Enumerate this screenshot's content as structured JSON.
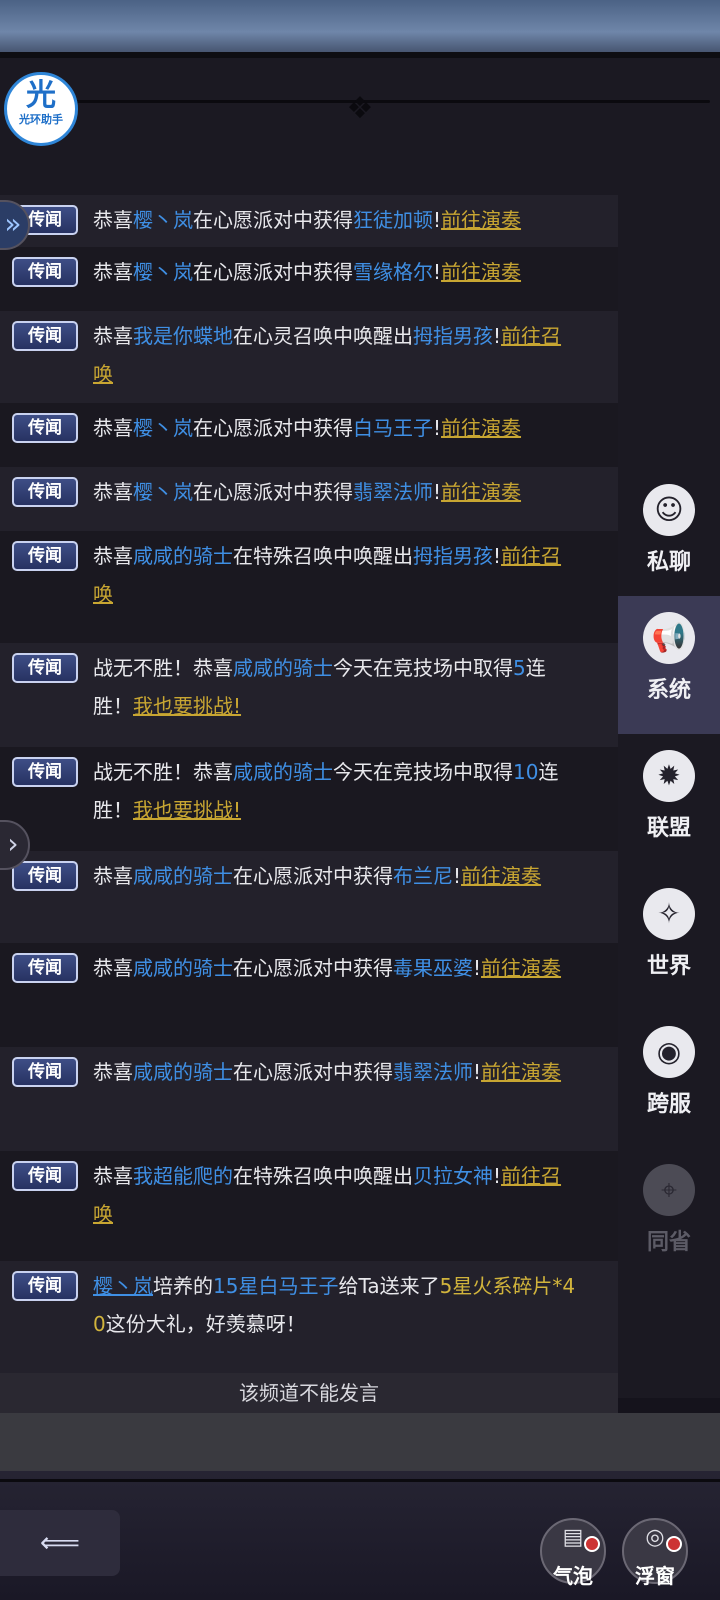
{
  "assistant": {
    "glyph": "光",
    "label": "光环助手"
  },
  "tag_label": "传闻",
  "messages": [
    {
      "parts": [
        {
          "t": "恭喜",
          "c": ""
        },
        {
          "t": "樱丶岚",
          "c": "blue"
        },
        {
          "t": "在心愿派对中获得",
          "c": ""
        },
        {
          "t": "狂徒加顿",
          "c": "blue"
        },
        {
          "t": "!",
          "c": ""
        },
        {
          "t": "前往演奏",
          "c": "link"
        }
      ]
    },
    {
      "parts": [
        {
          "t": "恭喜",
          "c": ""
        },
        {
          "t": "樱丶岚",
          "c": "blue"
        },
        {
          "t": "在心愿派对中获得",
          "c": ""
        },
        {
          "t": "雪缘格尔",
          "c": "blue"
        },
        {
          "t": "!",
          "c": ""
        },
        {
          "t": "前往演奏",
          "c": "link"
        }
      ]
    },
    {
      "parts": [
        {
          "t": "恭喜",
          "c": ""
        },
        {
          "t": "我是你蝶地",
          "c": "blue"
        },
        {
          "t": "在心灵召唤中唤醒出",
          "c": ""
        },
        {
          "t": "拇指男孩",
          "c": "blue"
        },
        {
          "t": "!",
          "c": ""
        },
        {
          "t": "前往召唤",
          "c": "link"
        }
      ]
    },
    {
      "parts": [
        {
          "t": "恭喜",
          "c": ""
        },
        {
          "t": "樱丶岚",
          "c": "blue"
        },
        {
          "t": "在心愿派对中获得",
          "c": ""
        },
        {
          "t": "白马王子",
          "c": "blue"
        },
        {
          "t": "!",
          "c": ""
        },
        {
          "t": "前往演奏",
          "c": "link"
        }
      ]
    },
    {
      "parts": [
        {
          "t": "恭喜",
          "c": ""
        },
        {
          "t": "樱丶岚",
          "c": "blue"
        },
        {
          "t": "在心愿派对中获得",
          "c": ""
        },
        {
          "t": "翡翠法师",
          "c": "blue"
        },
        {
          "t": "!",
          "c": ""
        },
        {
          "t": "前往演奏",
          "c": "link"
        }
      ]
    },
    {
      "parts": [
        {
          "t": "恭喜",
          "c": ""
        },
        {
          "t": "咸咸的骑士",
          "c": "blue"
        },
        {
          "t": "在特殊召唤中唤醒出",
          "c": ""
        },
        {
          "t": "拇指男孩",
          "c": "blue"
        },
        {
          "t": "!",
          "c": ""
        },
        {
          "t": "前往召唤",
          "c": "link"
        }
      ]
    },
    {
      "parts": [
        {
          "t": "战无不胜！恭喜",
          "c": ""
        },
        {
          "t": "咸咸的骑士",
          "c": "blue"
        },
        {
          "t": "今天在竞技场中取得",
          "c": ""
        },
        {
          "t": "5",
          "c": "blue"
        },
        {
          "t": "连胜！",
          "c": ""
        },
        {
          "t": "我也要挑战!",
          "c": "link"
        }
      ]
    },
    {
      "parts": [
        {
          "t": "战无不胜！恭喜",
          "c": ""
        },
        {
          "t": "咸咸的骑士",
          "c": "blue"
        },
        {
          "t": "今天在竞技场中取得",
          "c": ""
        },
        {
          "t": "10",
          "c": "blue"
        },
        {
          "t": "连胜！",
          "c": ""
        },
        {
          "t": "我也要挑战!",
          "c": "link"
        }
      ]
    },
    {
      "parts": [
        {
          "t": "恭喜",
          "c": ""
        },
        {
          "t": "咸咸的骑士",
          "c": "blue"
        },
        {
          "t": "在心愿派对中获得",
          "c": ""
        },
        {
          "t": "布兰尼",
          "c": "blue"
        },
        {
          "t": "!",
          "c": ""
        },
        {
          "t": "前往演奏",
          "c": "link"
        }
      ]
    },
    {
      "parts": [
        {
          "t": "恭喜",
          "c": ""
        },
        {
          "t": "咸咸的骑士",
          "c": "blue"
        },
        {
          "t": "在心愿派对中获得",
          "c": ""
        },
        {
          "t": "毒果巫婆",
          "c": "blue"
        },
        {
          "t": "!",
          "c": ""
        },
        {
          "t": "前往演奏",
          "c": "link"
        }
      ]
    },
    {
      "parts": [
        {
          "t": "恭喜",
          "c": ""
        },
        {
          "t": "咸咸的骑士",
          "c": "blue"
        },
        {
          "t": "在心愿派对中获得",
          "c": ""
        },
        {
          "t": "翡翠法师",
          "c": "blue"
        },
        {
          "t": "!",
          "c": ""
        },
        {
          "t": "前往演奏",
          "c": "link"
        }
      ]
    },
    {
      "parts": [
        {
          "t": "恭喜",
          "c": ""
        },
        {
          "t": "我超能爬的",
          "c": "blue"
        },
        {
          "t": "在特殊召唤中唤醒出",
          "c": ""
        },
        {
          "t": "贝拉女神",
          "c": "blue"
        },
        {
          "t": "!",
          "c": ""
        },
        {
          "t": "前往召唤",
          "c": "link"
        }
      ]
    },
    {
      "parts": [
        {
          "t": "樱丶岚",
          "c": "bluelink"
        },
        {
          "t": "培养的",
          "c": ""
        },
        {
          "t": "15星白马王子",
          "c": "blue"
        },
        {
          "t": "给Ta送来了",
          "c": ""
        },
        {
          "t": "5星火系碎片*40",
          "c": "gold"
        },
        {
          "t": "这份大礼，好羡慕呀！",
          "c": ""
        }
      ]
    }
  ],
  "notice": "该频道不能发言",
  "sidebar": [
    {
      "label": "私聊",
      "icon": "private-chat-icon",
      "glyph": "☺",
      "active": false,
      "dim": false
    },
    {
      "label": "系统",
      "icon": "megaphone-icon",
      "glyph": "📢",
      "active": true,
      "dim": false
    },
    {
      "label": "联盟",
      "icon": "alliance-banner-icon",
      "glyph": "✹",
      "active": false,
      "dim": false
    },
    {
      "label": "世界",
      "icon": "compass-icon",
      "glyph": "✧",
      "active": false,
      "dim": false
    },
    {
      "label": "跨服",
      "icon": "planet-icon",
      "glyph": "◉",
      "active": false,
      "dim": false
    },
    {
      "label": "同省",
      "icon": "location-pin-icon",
      "glyph": "⌖",
      "active": false,
      "dim": true
    }
  ],
  "bottom": {
    "bubble_label": "气泡",
    "float_label": "浮窗"
  }
}
